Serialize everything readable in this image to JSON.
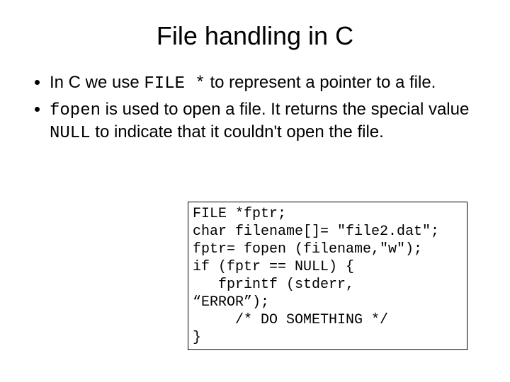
{
  "title": "File handling in C",
  "bullets": {
    "b1_parts": {
      "p1": "In C we use ",
      "code1": "FILE *",
      "p2": " to represent a pointer to a file."
    },
    "b2_parts": {
      "code1": "fopen",
      "p1": " is used to open a file.  It returns the special value ",
      "code2": "NULL",
      "p2": " to indicate that it couldn't open the file."
    }
  },
  "code": "FILE *fptr;\nchar filename[]= \"file2.dat\";\nfptr= fopen (filename,\"w\");\nif (fptr == NULL) {\n   fprintf (stderr,\n“ERROR”);\n     /* DO SOMETHING */\n}"
}
